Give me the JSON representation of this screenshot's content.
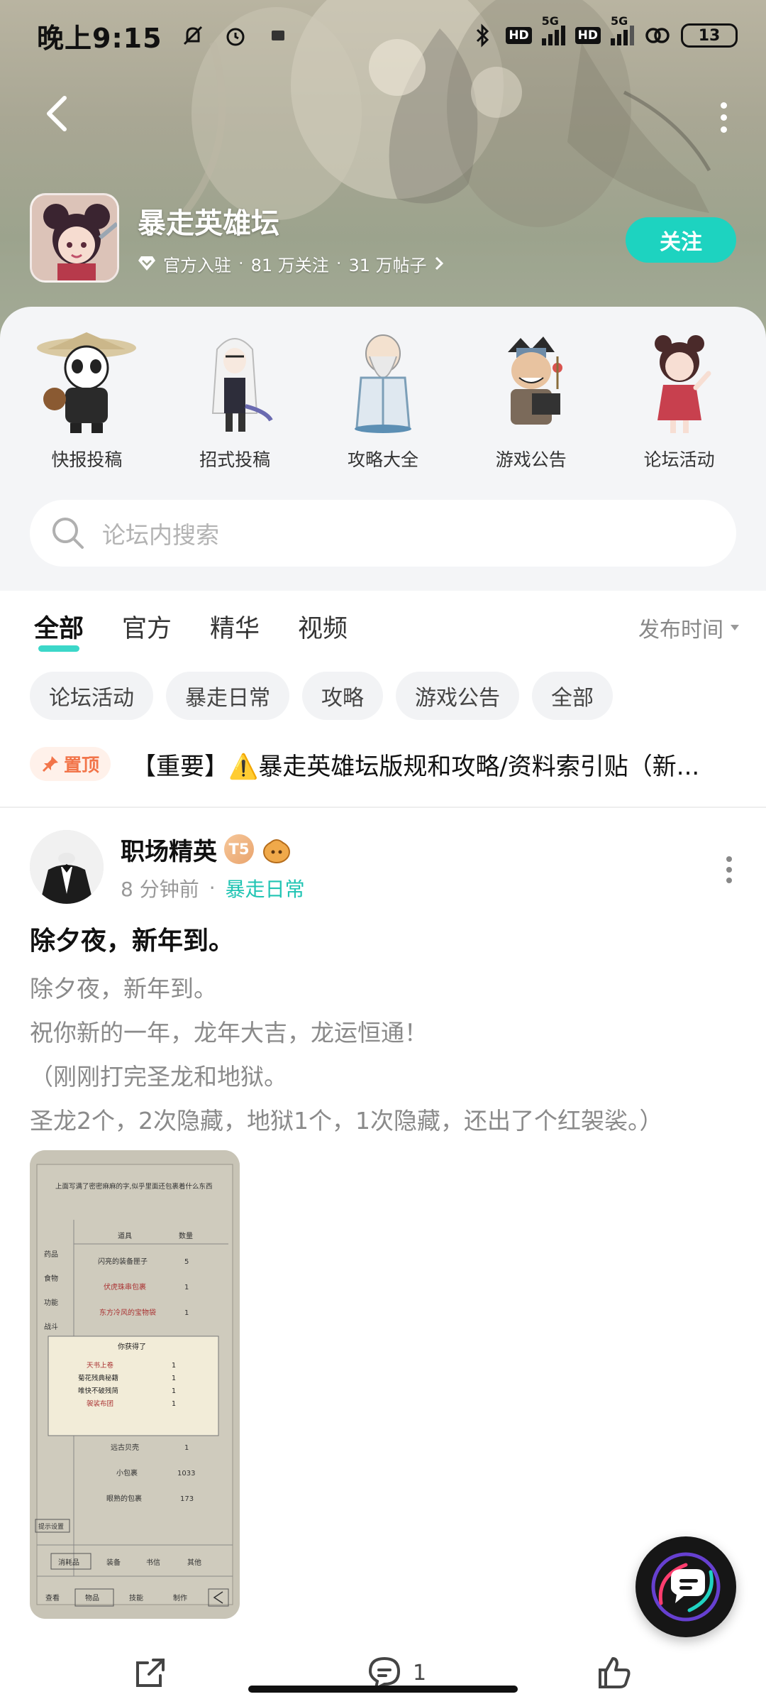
{
  "status_bar": {
    "time": "晚上9:15",
    "network_1": "5G",
    "network_2": "5G",
    "hd_1": "HD",
    "hd_2": "HD",
    "battery": "13"
  },
  "forum": {
    "name": "暴走英雄坛",
    "official": "官方入驻",
    "followers": "81 万关注",
    "posts": "31 万帖子",
    "follow_label": "关注"
  },
  "shortcuts": [
    {
      "label": "快报投稿",
      "icon": "panda-character-icon"
    },
    {
      "label": "招式投稿",
      "icon": "white-robed-character-icon"
    },
    {
      "label": "攻略大全",
      "icon": "elder-sage-character-icon"
    },
    {
      "label": "游戏公告",
      "icon": "announcer-character-icon"
    },
    {
      "label": "论坛活动",
      "icon": "girl-character-icon"
    }
  ],
  "search": {
    "placeholder": "论坛内搜索"
  },
  "tabs": [
    "全部",
    "官方",
    "精华",
    "视频"
  ],
  "sort_label": "发布时间",
  "chips": [
    "论坛活动",
    "暴走日常",
    "攻略",
    "游戏公告",
    "全部"
  ],
  "pinned": {
    "badge": "置顶",
    "text": "【重要】⚠️暴走英雄坛版规和攻略/资料索引贴（新..."
  },
  "post": {
    "author": "职场精英",
    "level": "T5",
    "time": "8 分钟前",
    "tag": "暴走日常",
    "title": "除夕夜，新年到。",
    "body": [
      "除夕夜，新年到。",
      "祝你新的一年，龙年大吉，龙运恒通！",
      "（刚刚打完圣龙和地狱。",
      "圣龙2个，2次隐藏，地狱1个，1次隐藏，还出了个红袈裟。）"
    ],
    "image": {
      "caption": "上面写满了密密麻麻的字,似乎里面还包裹着什么东西",
      "col_item": "道具",
      "col_qty": "数量",
      "side_tabs": [
        "药品",
        "食物",
        "功能",
        "战斗"
      ],
      "rows": [
        {
          "name": "闪亮的装备匣子",
          "qty": "5"
        },
        {
          "name": "伏虎珠串包裹",
          "qty": "1"
        },
        {
          "name": "东方冷风的宝物袋",
          "qty": "1"
        }
      ],
      "popup_title": "你获得了",
      "popup_rows": [
        {
          "name": "天书上卷",
          "qty": "1"
        },
        {
          "name": "菊花残典秘籍",
          "qty": "1"
        },
        {
          "name": "唯快不破残简",
          "qty": "1"
        },
        {
          "name": "袈裟布团",
          "qty": "1"
        }
      ],
      "rows2": [
        {
          "name": "远古贝壳",
          "qty": "1"
        },
        {
          "name": "小包裹",
          "qty": "1033"
        },
        {
          "name": "眼熟的包裹",
          "qty": "173"
        }
      ],
      "hint_btn": "提示设置",
      "bottom_tabs": [
        "消耗品",
        "装备",
        "书信",
        "其他"
      ],
      "nav_tabs": [
        "查看",
        "物品",
        "技能",
        "制作"
      ]
    }
  },
  "actions": {
    "comments": "1"
  }
}
